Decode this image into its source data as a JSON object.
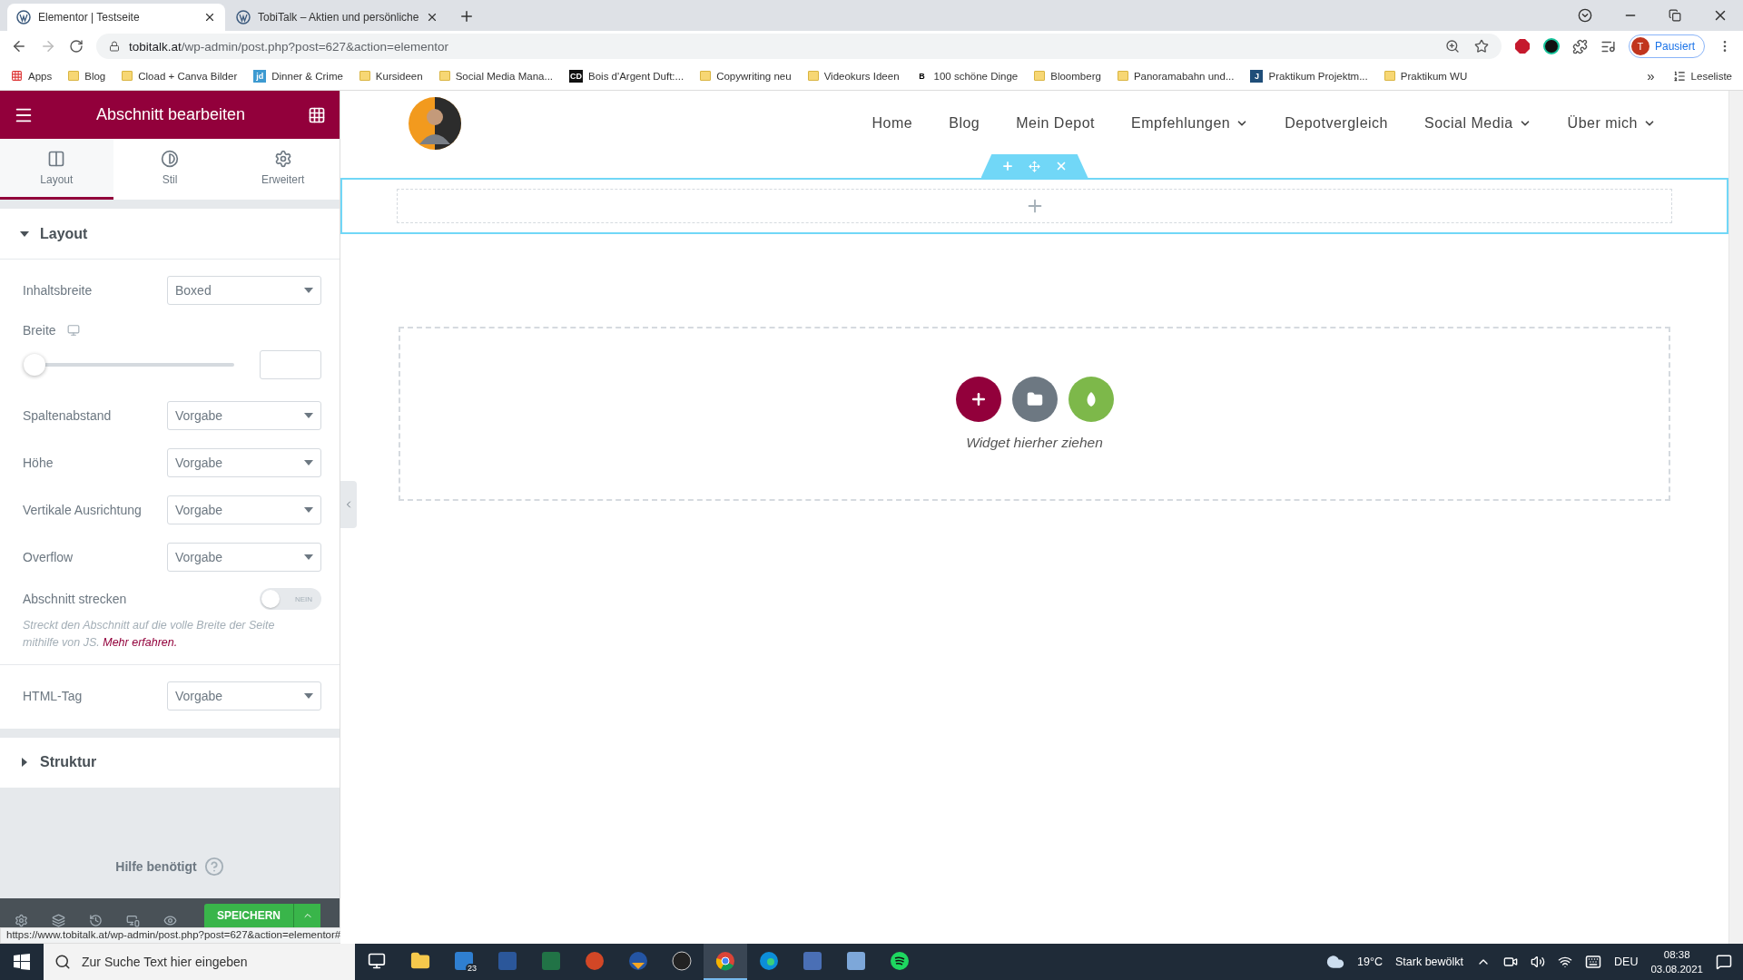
{
  "browser": {
    "tabs": [
      {
        "title": "Elementor | Testseite",
        "selected": true
      },
      {
        "title": "TobiTalk – Aktien und persönliche",
        "selected": false
      }
    ],
    "url_host": "tobitalk.at",
    "url_path": "/wp-admin/post.php?post=627&action=elementor",
    "profile": {
      "initial": "T",
      "label": "Pausiert"
    },
    "bookmarks": [
      {
        "label": "Apps",
        "kind": "apps"
      },
      {
        "label": "Blog",
        "kind": "folder"
      },
      {
        "label": "Cload + Canva Bilder",
        "kind": "folder"
      },
      {
        "label": "Dinner & Crime",
        "kind": "site",
        "badge": "jd",
        "color": "#3d9ad1"
      },
      {
        "label": "Kursideen",
        "kind": "folder"
      },
      {
        "label": "Social Media Mana...",
        "kind": "folder"
      },
      {
        "label": "Bois d'Argent Duft:...",
        "kind": "site",
        "badge": "CD",
        "color": "#111111"
      },
      {
        "label": "Copywriting neu",
        "kind": "folder"
      },
      {
        "label": "Videokurs Ideen",
        "kind": "folder"
      },
      {
        "label": "100 schöne Dinge",
        "kind": "site",
        "badge": "B",
        "color": "#ffffff"
      },
      {
        "label": "Bloomberg",
        "kind": "folder"
      },
      {
        "label": "Panoramabahn und...",
        "kind": "folder"
      },
      {
        "label": "Praktikum Projektm...",
        "kind": "site",
        "badge": "J",
        "color": "#1f4e79"
      },
      {
        "label": "Praktikum WU",
        "kind": "folder"
      }
    ],
    "more": "»",
    "reading_list": "Leseliste"
  },
  "panel": {
    "title": "Abschnitt bearbeiten",
    "tabs": [
      {
        "label": "Layout",
        "selected": true
      },
      {
        "label": "Stil",
        "selected": false
      },
      {
        "label": "Erweitert",
        "selected": false
      }
    ],
    "sections": [
      {
        "title": "Layout",
        "expanded": true,
        "controls": [
          {
            "kind": "select",
            "label": "Inhaltsbreite",
            "value": "Boxed"
          },
          {
            "kind": "slider",
            "label": "Breite",
            "level": 0
          },
          {
            "kind": "select",
            "label": "Spaltenabstand",
            "value": "Vorgabe"
          },
          {
            "kind": "select",
            "label": "Höhe",
            "value": "Vorgabe"
          },
          {
            "kind": "select",
            "label": "Vertikale Ausrichtung",
            "value": "Vorgabe"
          },
          {
            "kind": "select",
            "label": "Overflow",
            "value": "Vorgabe"
          },
          {
            "kind": "toggle",
            "label": "Abschnitt strecken",
            "on": false,
            "state_text": "NEIN",
            "note": "Streckt den Abschnitt auf die volle Breite der Seite mithilfe von JS.",
            "link": "Mehr erfahren."
          },
          {
            "kind": "select",
            "label": "HTML-Tag",
            "value": "Vorgabe"
          }
        ]
      },
      {
        "title": "Struktur",
        "expanded": false
      }
    ],
    "help": "Hilfe benötigt",
    "save": "SPEICHERN"
  },
  "status_url": "https://www.tobitalk.at/wp-admin/post.php?post=627&action=elementor#",
  "canvas": {
    "nav": [
      {
        "label": "Home",
        "dropdown": false
      },
      {
        "label": "Blog",
        "dropdown": false
      },
      {
        "label": "Mein Depot",
        "dropdown": false
      },
      {
        "label": "Empfehlungen",
        "dropdown": true
      },
      {
        "label": "Depotvergleich",
        "dropdown": false
      },
      {
        "label": "Social Media",
        "dropdown": true
      },
      {
        "label": "Über mich",
        "dropdown": true
      }
    ],
    "dropzone": "Widget hierher ziehen"
  },
  "taskbar": {
    "search_placeholder": "Zur Suche Text hier eingeben",
    "apps": [
      {
        "kind": "taskview",
        "active": false
      },
      {
        "kind": "explorer",
        "active": false
      },
      {
        "kind": "mail",
        "active": false,
        "badge": "23"
      },
      {
        "kind": "word",
        "active": false
      },
      {
        "kind": "excel",
        "active": false
      },
      {
        "kind": "powerpoint",
        "active": false
      },
      {
        "kind": "orb",
        "active": false
      },
      {
        "kind": "obs",
        "active": false
      },
      {
        "kind": "chrome",
        "active": true
      },
      {
        "kind": "edge",
        "active": false
      },
      {
        "kind": "tool",
        "active": false
      },
      {
        "kind": "notes",
        "active": false
      },
      {
        "kind": "spotify",
        "active": false
      }
    ],
    "temperature": "19°C",
    "weather": "Stark bewölkt",
    "language": "DEU",
    "time": "08:38",
    "date": "03.08.2021"
  }
}
